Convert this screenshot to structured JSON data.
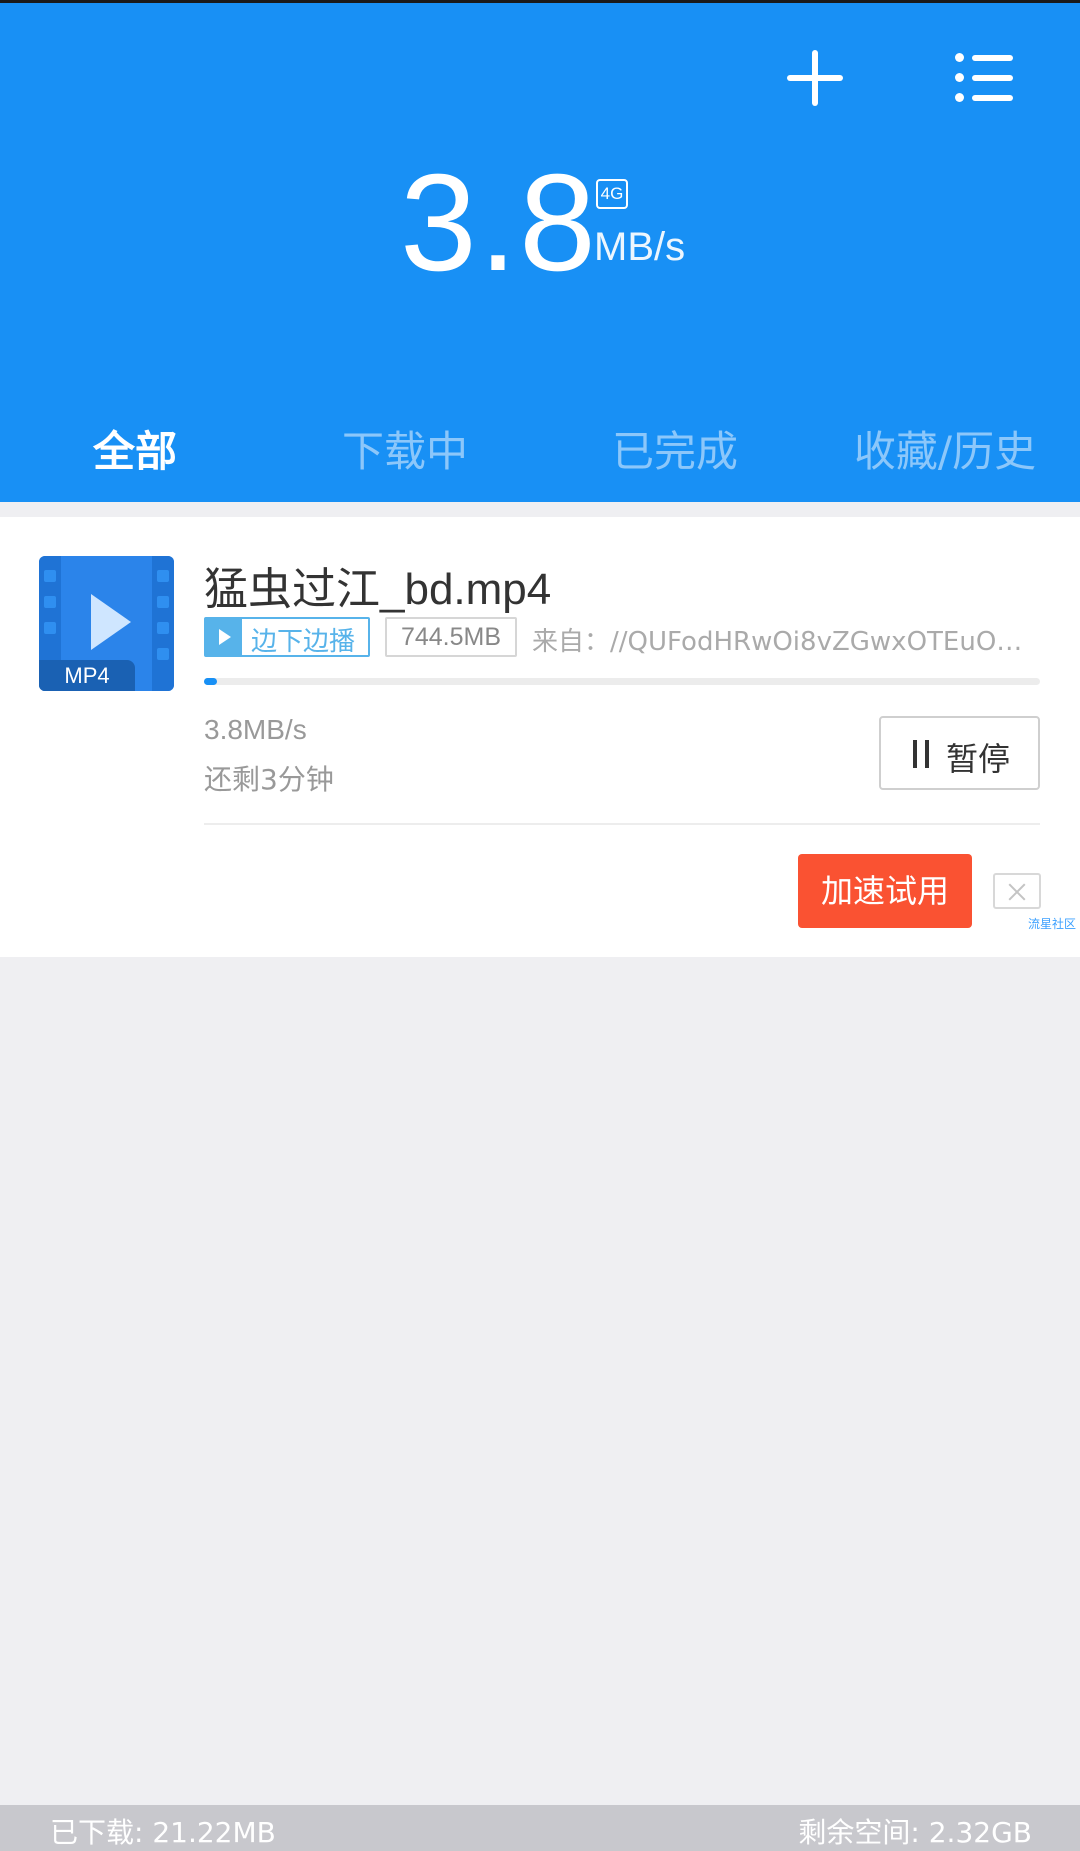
{
  "header": {
    "speed_value": "3.8",
    "network_badge": "4G",
    "speed_unit": "MB/s",
    "add_icon": "plus-icon",
    "menu_icon": "list-menu-icon",
    "background_color": "#1890f5"
  },
  "tabs": [
    {
      "label": "全部",
      "active": true
    },
    {
      "label": "下载中",
      "active": false
    },
    {
      "label": "已完成",
      "active": false
    },
    {
      "label": "收藏/历史",
      "active": false
    }
  ],
  "task": {
    "thumbnail_label": "MP4",
    "thumbnail_icon": "video-file-icon",
    "file_name": "猛虫过江_bd.mp4",
    "play_tag": "边下边播",
    "size": "744.5MB",
    "source": "来自：//QUFodHRwOi8vZGwxOTEuODBz...",
    "progress_fraction": 0.015,
    "speed": "3.8MB/s",
    "remaining": "还剩3分钟",
    "pause_label": "暂停",
    "boost_label": "加速试用",
    "boost_color": "#fa5232",
    "watermark": "流星社区"
  },
  "footer": {
    "downloaded": "已下载: 21.22MB",
    "free_space": "剩余空间: 2.32GB"
  }
}
